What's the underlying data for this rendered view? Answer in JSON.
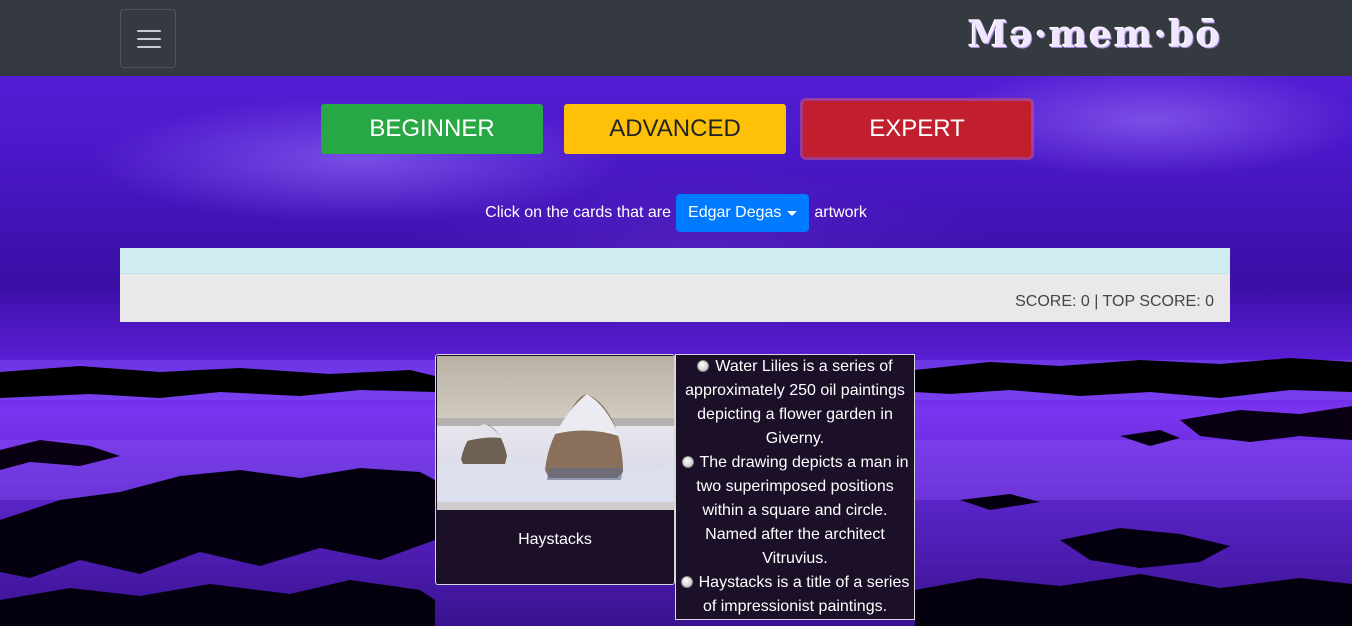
{
  "navbar": {
    "brand": "Mə·mem·bō",
    "menu_icon": "hamburger-icon"
  },
  "levels": {
    "beginner": "BEGINNER",
    "advanced": "ADVANCED",
    "expert": "EXPERT"
  },
  "prompt": {
    "before": "Click on the cards that are",
    "artist": "Edgar Degas",
    "after": "artwork"
  },
  "score": {
    "text": "SCORE: 0 | TOP SCORE: 0"
  },
  "card": {
    "title": "Haystacks",
    "image": "haystacks-painting"
  },
  "options": [
    "Water Lilies is a series of approximately 250 oil paintings depicting a flower garden in Giverny.",
    "The drawing depicts a man in two superimposed positions within a square and circle. Named after the architect Vitruvius.",
    "Haystacks is a title of a series of impressionist paintings."
  ],
  "colors": {
    "navbar": "#343a40",
    "beginner": "#28a745",
    "advanced": "#ffc107",
    "expert": "#c11e2e",
    "dropdown": "#007bff",
    "alert": "#d1ecf1",
    "card_bg": "#1c0f28"
  }
}
